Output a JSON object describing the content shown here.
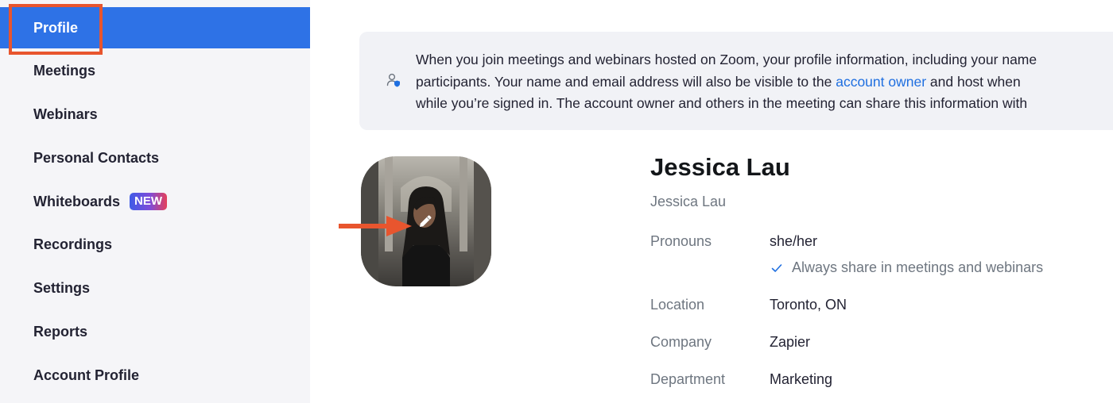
{
  "sidebar": {
    "items": [
      {
        "label": "Profile",
        "active": true
      },
      {
        "label": "Meetings"
      },
      {
        "label": "Webinars"
      },
      {
        "label": "Personal Contacts"
      },
      {
        "label": "Whiteboards",
        "badge": "NEW"
      },
      {
        "label": "Recordings"
      },
      {
        "label": "Settings"
      },
      {
        "label": "Reports"
      },
      {
        "label": "Account Profile"
      }
    ]
  },
  "notice": {
    "line1": "When you join meetings and webinars hosted on Zoom, your profile information, including your name",
    "line2_before": "participants. Your name and email address will also be visible to the ",
    "link": "account owner",
    "line2_after": " and host when",
    "line3": "while you’re signed in. The account owner and others in the meeting can share this information with"
  },
  "profile": {
    "name": "Jessica Lau",
    "display_name": "Jessica Lau",
    "pronouns_label": "Pronouns",
    "pronouns": "she/her",
    "pronouns_share": "Always share in meetings and webinars",
    "location_label": "Location",
    "location": "Toronto, ON",
    "company_label": "Company",
    "company": "Zapier",
    "department_label": "Department",
    "department": "Marketing"
  },
  "colors": {
    "accent": "#2e72e6",
    "highlight": "#e8552e",
    "link": "#1f6fe0"
  },
  "icons": {
    "notice": "user-privacy-icon",
    "edit": "pencil-icon",
    "check": "check-icon"
  }
}
